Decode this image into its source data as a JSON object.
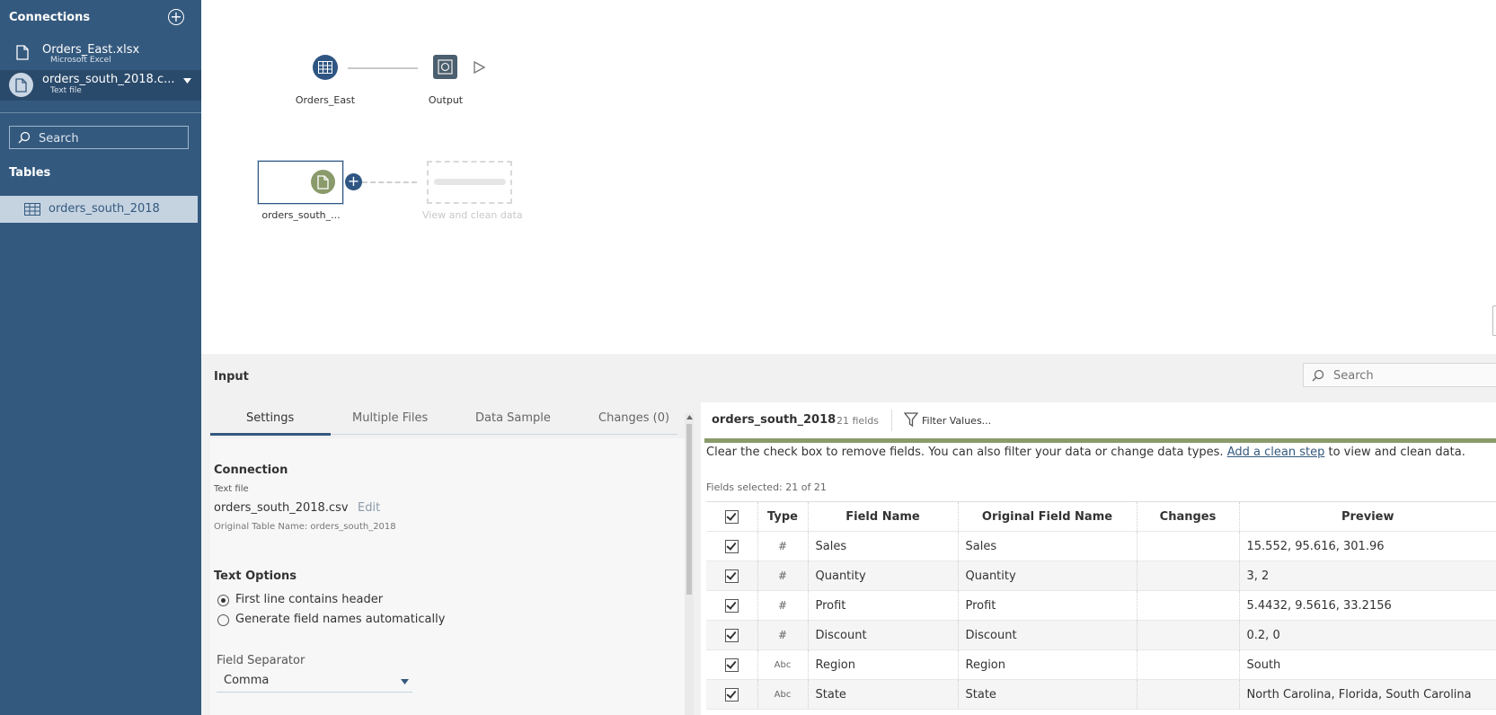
{
  "sidebar": {
    "connections_title": "Connections",
    "connections": [
      {
        "name": "Orders_East.xlsx",
        "type": "Microsoft Excel"
      },
      {
        "name": "orders_south_2018.c...",
        "type": "Text file"
      }
    ],
    "search_placeholder": "Search",
    "tables_title": "Tables",
    "tables": [
      "orders_south_2018"
    ]
  },
  "canvas": {
    "nodes": {
      "orders_east": "Orders_East",
      "output": "Output",
      "orders_south": "orders_south_...",
      "ghost": "View and clean data"
    }
  },
  "input_panel": {
    "title": "Input",
    "search_placeholder": "Search",
    "tabs": [
      "Settings",
      "Multiple Files",
      "Data Sample",
      "Changes (0)"
    ],
    "connection": {
      "section_title": "Connection",
      "type_label": "Text file",
      "file_name": "orders_south_2018.csv",
      "edit_label": "Edit",
      "original_table_name": "Original Table Name: orders_south_2018"
    },
    "text_options": {
      "section_title": "Text Options",
      "options": [
        "First line contains header",
        "Generate field names automatically"
      ],
      "selected_index": 0
    },
    "field_separator": {
      "label": "Field Separator",
      "value": "Comma"
    }
  },
  "fields_panel": {
    "table_name": "orders_south_2018",
    "field_count": "21 fields",
    "filter_label": "Filter Values...",
    "hint_prefix": "Clear the check box to remove fields. You can also filter your data or change data types.",
    "hint_link": "Add a clean step",
    "hint_suffix": "to view and clean data.",
    "fields_selected": "Fields selected: 21 of 21",
    "columns": [
      "Type",
      "Field Name",
      "Original Field Name",
      "Changes",
      "Preview"
    ],
    "rows": [
      {
        "type": "#",
        "field": "Sales",
        "original": "Sales",
        "changes": "",
        "preview": "15.552, 95.616, 301.96"
      },
      {
        "type": "#",
        "field": "Quantity",
        "original": "Quantity",
        "changes": "",
        "preview": "3, 2"
      },
      {
        "type": "#",
        "field": "Profit",
        "original": "Profit",
        "changes": "",
        "preview": "5.4432, 9.5616, 33.2156"
      },
      {
        "type": "#",
        "field": "Discount",
        "original": "Discount",
        "changes": "",
        "preview": "0.2, 0"
      },
      {
        "type": "Abc",
        "field": "Region",
        "original": "Region",
        "changes": "",
        "preview": "South"
      },
      {
        "type": "Abc",
        "field": "State",
        "original": "State",
        "changes": "",
        "preview": "North Carolina, Florida, South Carolina"
      }
    ]
  },
  "colors": {
    "sidebar_bg": "#34597e",
    "accent_green": "#8a9a6b",
    "node_blue": "#2f5683"
  }
}
